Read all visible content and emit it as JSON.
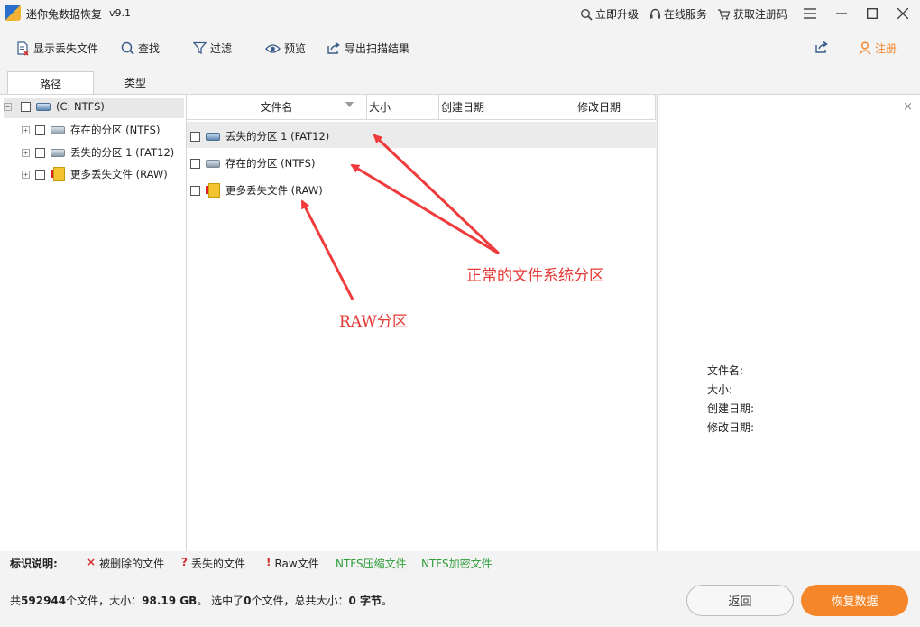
{
  "titlebar": {
    "app_title": "迷你兔数据恢复",
    "version": "v9.1",
    "upgrade": "立即升级",
    "online_service": "在线服务",
    "get_reg_code": "获取注册码"
  },
  "toolbar": {
    "show_lost_files": "显示丢失文件",
    "find": "查找",
    "filter": "过滤",
    "preview": "预览",
    "export_results": "导出扫描结果",
    "register": "注册"
  },
  "tabs": [
    "路径",
    "类型"
  ],
  "tree": {
    "root": "(C: NTFS)",
    "items": [
      "存在的分区 (NTFS)",
      "丢失的分区 1 (FAT12)",
      "更多丢失文件 (RAW)"
    ]
  },
  "list": {
    "columns": [
      "文件名",
      "大小",
      "创建日期",
      "修改日期"
    ],
    "rows": [
      "丢失的分区 1 (FAT12)",
      "存在的分区 (NTFS)",
      "更多丢失文件 (RAW)"
    ]
  },
  "annotations": {
    "normal": "正常的文件系统分区",
    "raw": "RAW分区"
  },
  "preview": {
    "filename": "文件名:",
    "size": "大小:",
    "created": "创建日期:",
    "modified": "修改日期:"
  },
  "legend": {
    "title": "标识说明:",
    "deleted": "被删除的文件",
    "lost": "丢失的文件",
    "raw": "Raw文件",
    "ntfs_compressed": "NTFS压缩文件",
    "ntfs_encrypted": "NTFS加密文件"
  },
  "status": {
    "prefix": "共",
    "file_count": "592944",
    "files_size_label": "个文件，大小：",
    "size": "98.19 GB",
    "selected_label": "。 选中了",
    "selected_count": "0",
    "selected_suffix": "个文件，总共大小：",
    "selected_size": "0 字节",
    "end": "。"
  },
  "buttons": {
    "back": "返回",
    "recover": "恢复数据"
  },
  "colors": {
    "accent_orange": "#f5862a",
    "annotation_red": "#e53935",
    "legend_green": "#2e9e3a"
  }
}
